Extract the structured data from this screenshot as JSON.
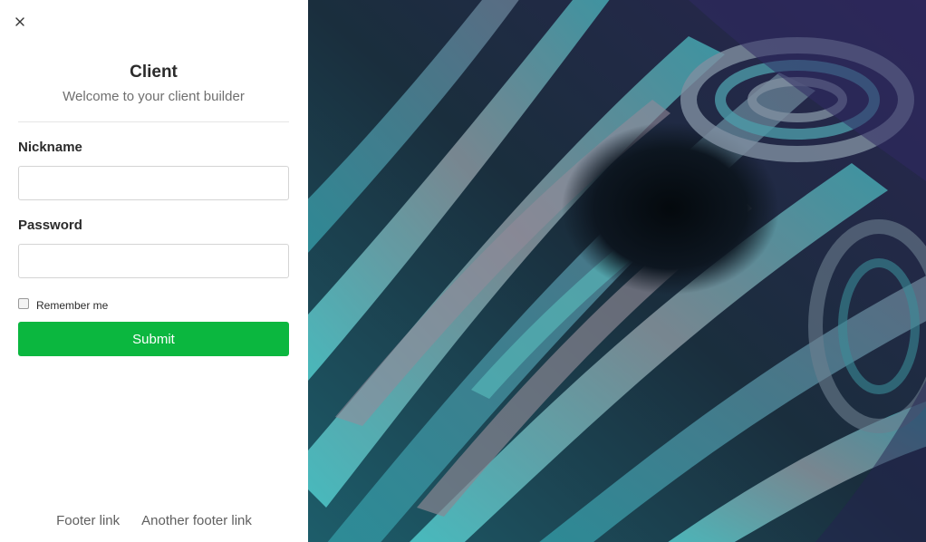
{
  "panel": {
    "close_glyph": "×",
    "title": "Client",
    "subtitle": "Welcome to your client builder"
  },
  "form": {
    "nickname_label": "Nickname",
    "nickname_value": "",
    "password_label": "Password",
    "password_value": "",
    "remember_label": "Remember me",
    "remember_checked": false,
    "submit_label": "Submit"
  },
  "footer": {
    "links": [
      "Footer link",
      "Another footer link"
    ]
  },
  "colors": {
    "submit_bg": "#0bb73f",
    "art_dark": "#14202a",
    "art_teal": "#3fb8b8",
    "art_purple": "#4a3f8f",
    "art_grey": "#8a8a92"
  },
  "icons": {
    "close": "close-icon",
    "checkbox": "checkbox-icon"
  }
}
